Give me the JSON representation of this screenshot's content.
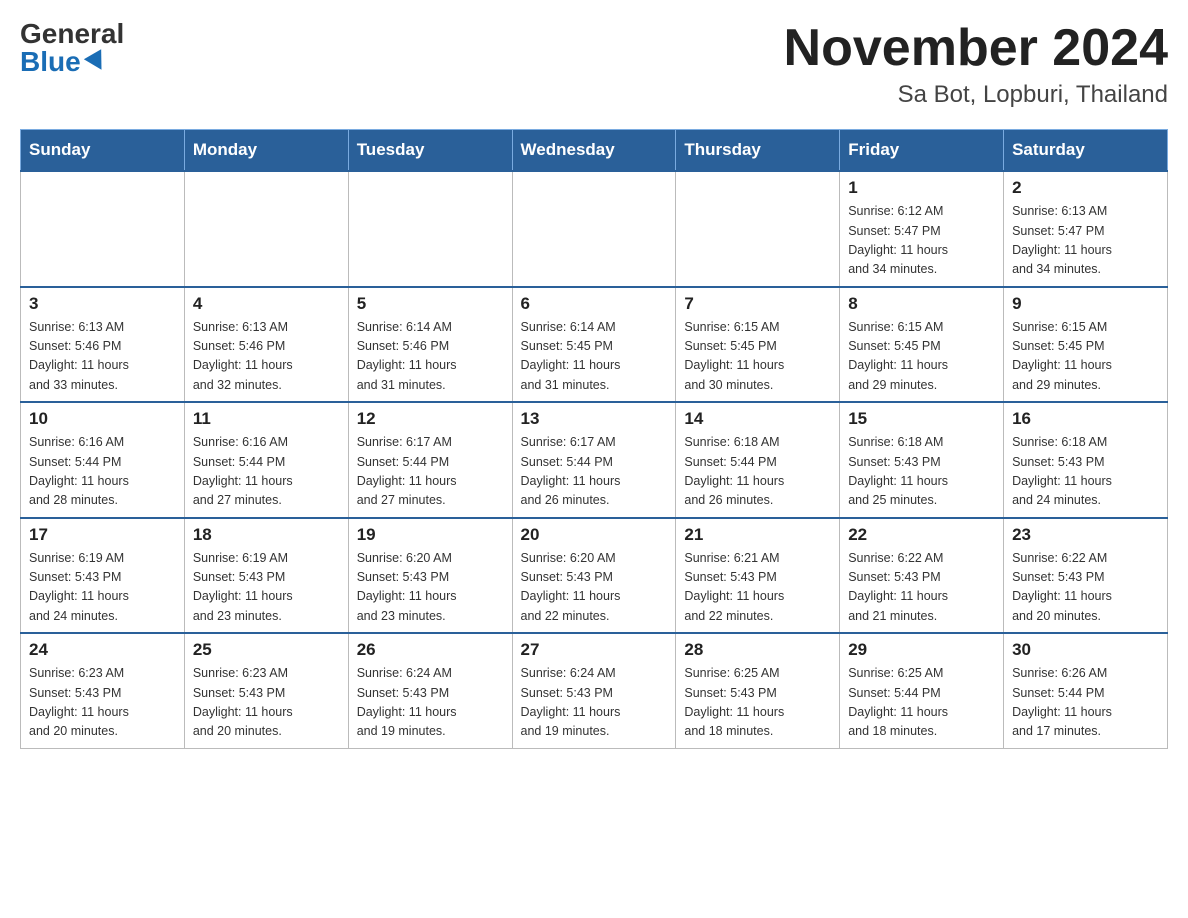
{
  "header": {
    "logo_general": "General",
    "logo_blue": "Blue",
    "title": "November 2024",
    "subtitle": "Sa Bot, Lopburi, Thailand"
  },
  "days_of_week": [
    "Sunday",
    "Monday",
    "Tuesday",
    "Wednesday",
    "Thursday",
    "Friday",
    "Saturday"
  ],
  "weeks": [
    [
      {
        "day": "",
        "info": ""
      },
      {
        "day": "",
        "info": ""
      },
      {
        "day": "",
        "info": ""
      },
      {
        "day": "",
        "info": ""
      },
      {
        "day": "",
        "info": ""
      },
      {
        "day": "1",
        "info": "Sunrise: 6:12 AM\nSunset: 5:47 PM\nDaylight: 11 hours\nand 34 minutes."
      },
      {
        "day": "2",
        "info": "Sunrise: 6:13 AM\nSunset: 5:47 PM\nDaylight: 11 hours\nand 34 minutes."
      }
    ],
    [
      {
        "day": "3",
        "info": "Sunrise: 6:13 AM\nSunset: 5:46 PM\nDaylight: 11 hours\nand 33 minutes."
      },
      {
        "day": "4",
        "info": "Sunrise: 6:13 AM\nSunset: 5:46 PM\nDaylight: 11 hours\nand 32 minutes."
      },
      {
        "day": "5",
        "info": "Sunrise: 6:14 AM\nSunset: 5:46 PM\nDaylight: 11 hours\nand 31 minutes."
      },
      {
        "day": "6",
        "info": "Sunrise: 6:14 AM\nSunset: 5:45 PM\nDaylight: 11 hours\nand 31 minutes."
      },
      {
        "day": "7",
        "info": "Sunrise: 6:15 AM\nSunset: 5:45 PM\nDaylight: 11 hours\nand 30 minutes."
      },
      {
        "day": "8",
        "info": "Sunrise: 6:15 AM\nSunset: 5:45 PM\nDaylight: 11 hours\nand 29 minutes."
      },
      {
        "day": "9",
        "info": "Sunrise: 6:15 AM\nSunset: 5:45 PM\nDaylight: 11 hours\nand 29 minutes."
      }
    ],
    [
      {
        "day": "10",
        "info": "Sunrise: 6:16 AM\nSunset: 5:44 PM\nDaylight: 11 hours\nand 28 minutes."
      },
      {
        "day": "11",
        "info": "Sunrise: 6:16 AM\nSunset: 5:44 PM\nDaylight: 11 hours\nand 27 minutes."
      },
      {
        "day": "12",
        "info": "Sunrise: 6:17 AM\nSunset: 5:44 PM\nDaylight: 11 hours\nand 27 minutes."
      },
      {
        "day": "13",
        "info": "Sunrise: 6:17 AM\nSunset: 5:44 PM\nDaylight: 11 hours\nand 26 minutes."
      },
      {
        "day": "14",
        "info": "Sunrise: 6:18 AM\nSunset: 5:44 PM\nDaylight: 11 hours\nand 26 minutes."
      },
      {
        "day": "15",
        "info": "Sunrise: 6:18 AM\nSunset: 5:43 PM\nDaylight: 11 hours\nand 25 minutes."
      },
      {
        "day": "16",
        "info": "Sunrise: 6:18 AM\nSunset: 5:43 PM\nDaylight: 11 hours\nand 24 minutes."
      }
    ],
    [
      {
        "day": "17",
        "info": "Sunrise: 6:19 AM\nSunset: 5:43 PM\nDaylight: 11 hours\nand 24 minutes."
      },
      {
        "day": "18",
        "info": "Sunrise: 6:19 AM\nSunset: 5:43 PM\nDaylight: 11 hours\nand 23 minutes."
      },
      {
        "day": "19",
        "info": "Sunrise: 6:20 AM\nSunset: 5:43 PM\nDaylight: 11 hours\nand 23 minutes."
      },
      {
        "day": "20",
        "info": "Sunrise: 6:20 AM\nSunset: 5:43 PM\nDaylight: 11 hours\nand 22 minutes."
      },
      {
        "day": "21",
        "info": "Sunrise: 6:21 AM\nSunset: 5:43 PM\nDaylight: 11 hours\nand 22 minutes."
      },
      {
        "day": "22",
        "info": "Sunrise: 6:22 AM\nSunset: 5:43 PM\nDaylight: 11 hours\nand 21 minutes."
      },
      {
        "day": "23",
        "info": "Sunrise: 6:22 AM\nSunset: 5:43 PM\nDaylight: 11 hours\nand 20 minutes."
      }
    ],
    [
      {
        "day": "24",
        "info": "Sunrise: 6:23 AM\nSunset: 5:43 PM\nDaylight: 11 hours\nand 20 minutes."
      },
      {
        "day": "25",
        "info": "Sunrise: 6:23 AM\nSunset: 5:43 PM\nDaylight: 11 hours\nand 20 minutes."
      },
      {
        "day": "26",
        "info": "Sunrise: 6:24 AM\nSunset: 5:43 PM\nDaylight: 11 hours\nand 19 minutes."
      },
      {
        "day": "27",
        "info": "Sunrise: 6:24 AM\nSunset: 5:43 PM\nDaylight: 11 hours\nand 19 minutes."
      },
      {
        "day": "28",
        "info": "Sunrise: 6:25 AM\nSunset: 5:43 PM\nDaylight: 11 hours\nand 18 minutes."
      },
      {
        "day": "29",
        "info": "Sunrise: 6:25 AM\nSunset: 5:44 PM\nDaylight: 11 hours\nand 18 minutes."
      },
      {
        "day": "30",
        "info": "Sunrise: 6:26 AM\nSunset: 5:44 PM\nDaylight: 11 hours\nand 17 minutes."
      }
    ]
  ]
}
